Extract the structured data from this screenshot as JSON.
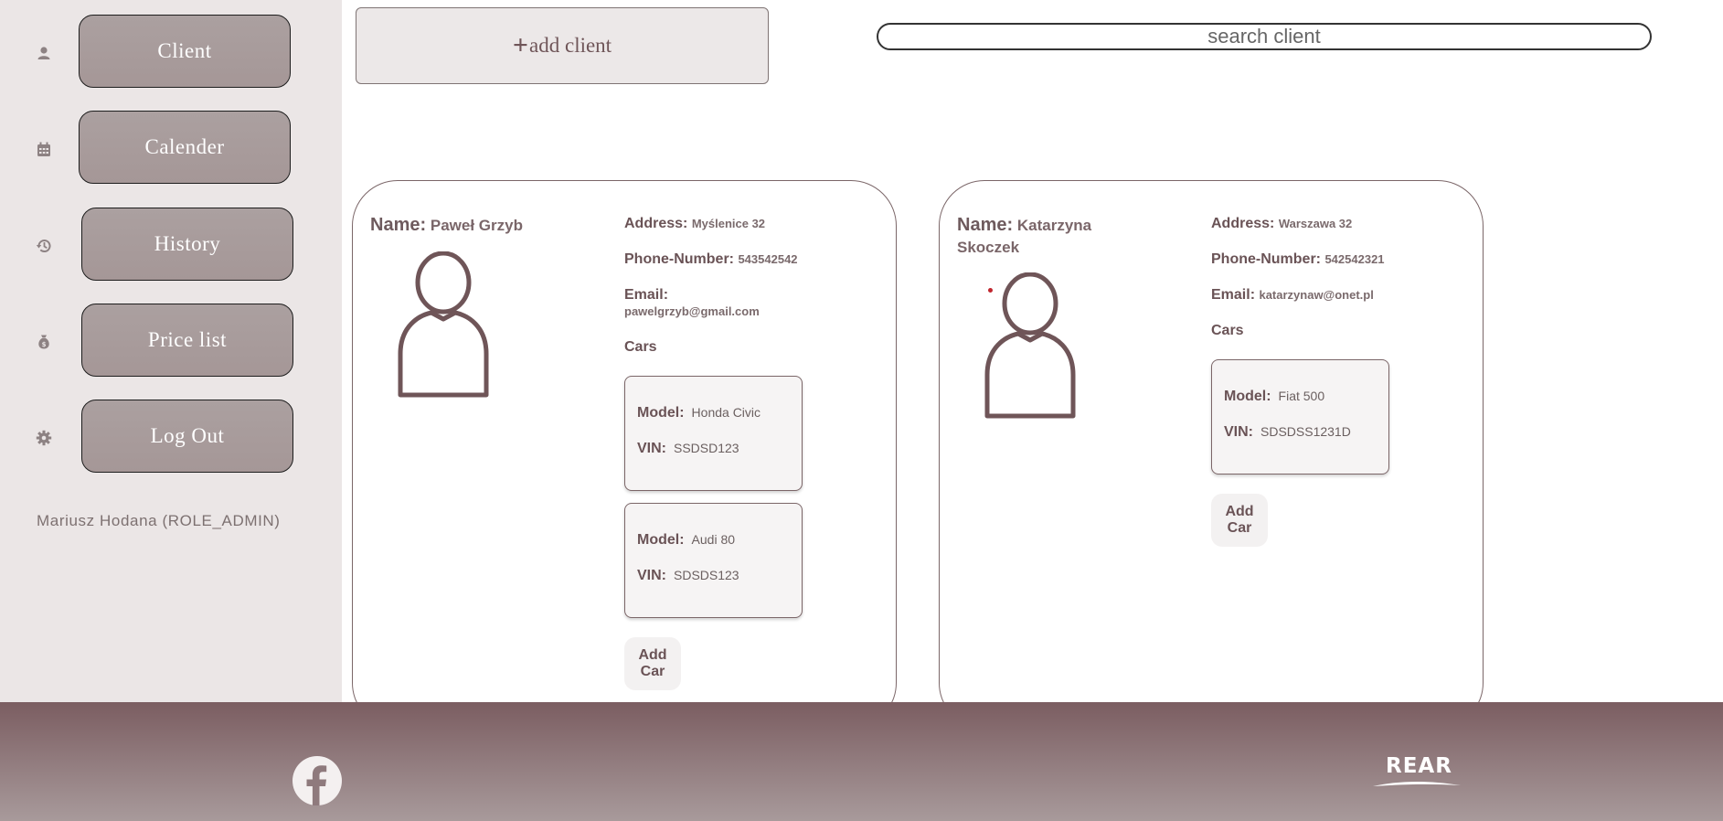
{
  "sidebar": {
    "items": [
      {
        "label": "Client",
        "icon": "user-icon"
      },
      {
        "label": "Calender",
        "icon": "calendar-icon"
      },
      {
        "label": "History",
        "icon": "history-icon"
      },
      {
        "label": "Price list",
        "icon": "money-bag-icon"
      },
      {
        "label": "Log Out",
        "icon": "gear-icon"
      }
    ],
    "user": "Mariusz Hodana (ROLE_ADMIN)"
  },
  "toolbar": {
    "add_client_plus": "+",
    "add_client_label": "add client",
    "search_placeholder": "search client"
  },
  "labels": {
    "name": "Name:",
    "address": "Address:",
    "phone": "Phone-Number:",
    "email": "Email:",
    "cars": "Cars",
    "model": "Model:",
    "vin": "VIN:",
    "add_car": "Add Car"
  },
  "clients": [
    {
      "name": "Paweł Grzyb",
      "address": "Myślenice 32",
      "phone": "543542542",
      "email": "pawelgrzyb@gmail.com",
      "cars": [
        {
          "model": "Honda Civic",
          "vin": "SSDSD123"
        },
        {
          "model": "Audi 80",
          "vin": "SDSDS123"
        }
      ]
    },
    {
      "name": "Katarzyna Skoczek",
      "address": "Warszawa 32",
      "phone": "542542321",
      "email": "katarzynaw@onet.pl",
      "cars": [
        {
          "model": "Fiat 500",
          "vin": "SDSDSS1231D"
        }
      ]
    }
  ],
  "footer": {
    "social_icon": "facebook-icon",
    "logo_text": "REAR"
  },
  "colors": {
    "accent": "#6f5558",
    "sidebar_bg": "#ebe6e6",
    "nav_button": "#a89c9c",
    "footer_top": "#7b5d61"
  }
}
